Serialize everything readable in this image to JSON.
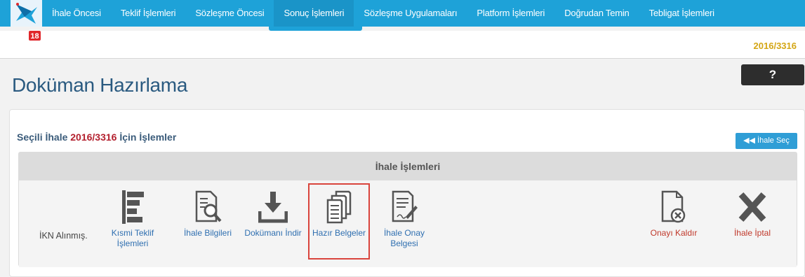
{
  "nav": {
    "notification_count": "18",
    "items": [
      {
        "label": "İhale Öncesi"
      },
      {
        "label": "Teklif İşlemleri"
      },
      {
        "label": "Sözleşme Öncesi"
      },
      {
        "label": "Sonuç İşlemleri"
      },
      {
        "label": "Sözleşme Uygulamaları"
      },
      {
        "label": "Platform İşlemleri"
      },
      {
        "label": "Doğrudan Temin"
      },
      {
        "label": "Tebligat İşlemleri"
      }
    ],
    "active_index": 3
  },
  "subbar": {
    "ref_no": "2016/3316"
  },
  "page": {
    "title": "Doküman Hazırlama",
    "help_label": "?"
  },
  "panel": {
    "heading_prefix": "Seçili İhale ",
    "heading_ref": "2016/3316",
    "heading_suffix": " İçin İşlemler",
    "select_button": "İhale Seç",
    "table_header": "İhale İşlemleri",
    "status": "İKN Alınmış.",
    "operations": [
      {
        "label_line1": "Kısmi Teklif",
        "label_line2": "İşlemleri",
        "icon": "list-bars-icon"
      },
      {
        "label_line1": "İhale Bilgileri",
        "label_line2": "",
        "icon": "document-search-icon"
      },
      {
        "label_line1": "Dokümanı İndir",
        "label_line2": "",
        "icon": "download-icon"
      },
      {
        "label_line1": "Hazır Belgeler",
        "label_line2": "",
        "icon": "stacked-documents-icon"
      },
      {
        "label_line1": "İhale Onay",
        "label_line2": "Belgesi",
        "icon": "document-sign-icon"
      },
      {
        "label_line1": "Onayı Kaldır",
        "label_line2": "",
        "icon": "document-remove-icon"
      },
      {
        "label_line1": "İhale İptal",
        "label_line2": "",
        "icon": "x-cancel-icon"
      }
    ]
  },
  "colors": {
    "nav_bg": "#1ea2d8",
    "ref_gold": "#d4a614",
    "title_blue": "#2a5a80",
    "heading_red": "#b31f2d",
    "link_blue": "#2f6fb0",
    "danger_red": "#c0392b",
    "highlight_red": "#d9443c"
  }
}
